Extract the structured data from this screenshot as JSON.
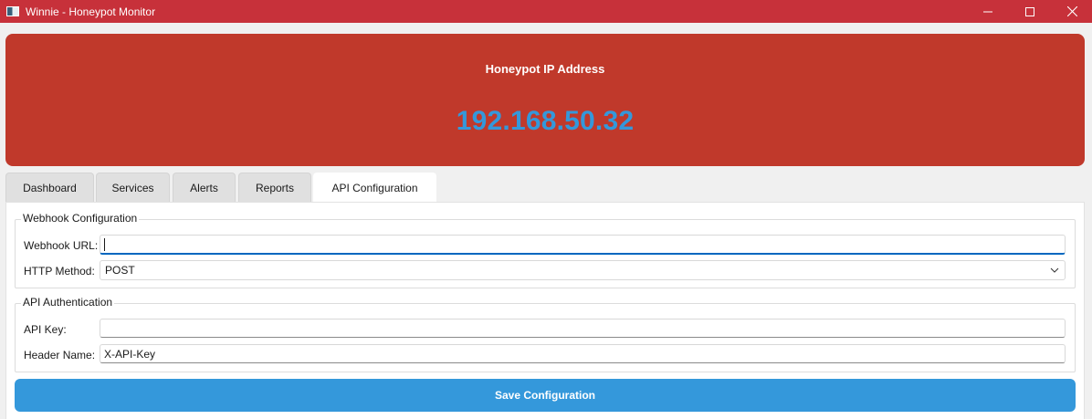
{
  "window": {
    "title": "Winnie - Honeypot Monitor"
  },
  "banner": {
    "label": "Honeypot IP Address",
    "ip": "192.168.50.32"
  },
  "tabs": [
    {
      "label": "Dashboard",
      "active": false
    },
    {
      "label": "Services",
      "active": false
    },
    {
      "label": "Alerts",
      "active": false
    },
    {
      "label": "Reports",
      "active": false
    },
    {
      "label": "API Configuration",
      "active": true
    }
  ],
  "webhook": {
    "group_title": "Webhook Configuration",
    "url_label": "Webhook URL:",
    "url_value": "",
    "method_label": "HTTP Method:",
    "method_value": "POST"
  },
  "auth": {
    "group_title": "API Authentication",
    "key_label": "API Key:",
    "key_value": "",
    "header_label": "Header Name:",
    "header_value": "X-API-Key"
  },
  "actions": {
    "save_label": "Save Configuration"
  },
  "colors": {
    "titlebar": "#c7313a",
    "banner": "#c0392b",
    "ip_text": "#3498db",
    "save_button": "#3498db"
  },
  "icons": {
    "app": "app-icon",
    "minimize": "minimize-icon",
    "maximize": "maximize-icon",
    "close": "close-icon",
    "dropdown": "chevron-down-icon"
  }
}
